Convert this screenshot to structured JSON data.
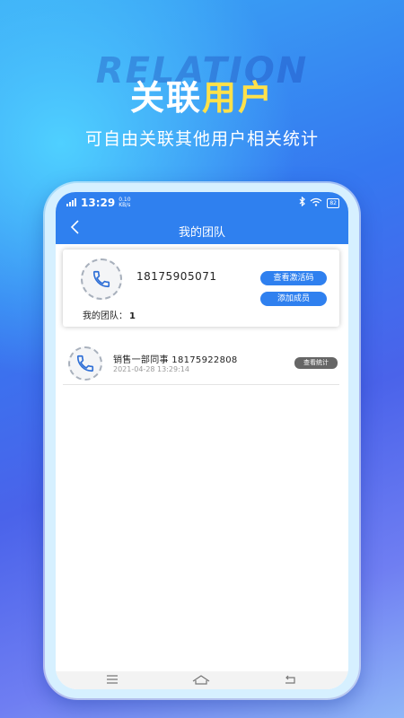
{
  "promo": {
    "watermark": "RELATION",
    "headline_white": "关联",
    "headline_yellow": "用户",
    "subheadline": "可自由关联其他用户相关统计"
  },
  "status_bar": {
    "time": "13:29",
    "net_speed_value": "0.10",
    "net_speed_unit": "KB/s",
    "battery": "82"
  },
  "nav": {
    "back_icon": "chevron-left-icon",
    "title": "我的团队"
  },
  "team_card": {
    "avatar_icon": "phone-icon",
    "phone": "18175905071",
    "team_label": "我的团队：",
    "team_count": "1",
    "view_code_label": "查看激活码",
    "add_member_label": "添加成员"
  },
  "members": [
    {
      "avatar_icon": "phone-icon",
      "name_phone": "销售一部同事 18175922808",
      "time": "2021-04-28 13:29:14",
      "stats_label": "查看统计"
    }
  ],
  "system_nav": {
    "menu_icon": "menu-icon",
    "home_icon": "home-icon",
    "back_icon": "back-icon"
  },
  "colors": {
    "accent": "#2f80ef",
    "highlight": "#ffe14a",
    "stats_button": "#666666"
  }
}
